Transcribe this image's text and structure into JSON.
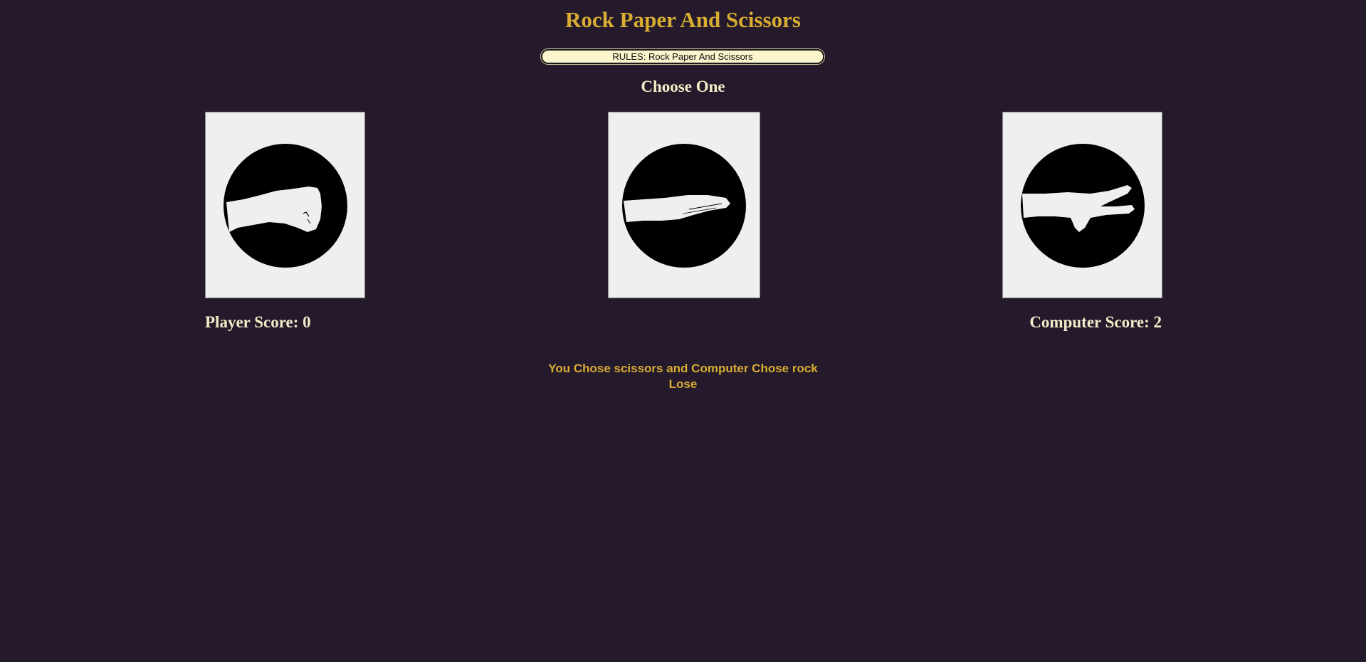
{
  "header": {
    "title": "Rock Paper And Scissors",
    "rules_button_label": "RULES: Rock Paper And Scissors",
    "choose_label": "Choose One"
  },
  "choices": [
    {
      "name": "rock",
      "icon": "rock-fist-icon"
    },
    {
      "name": "paper",
      "icon": "paper-hand-icon"
    },
    {
      "name": "scissors",
      "icon": "scissors-hand-icon"
    }
  ],
  "scores": {
    "player_label": "Player Score: 0",
    "computer_label": "Computer Score: 2",
    "player": 0,
    "computer": 2
  },
  "result": {
    "line1": "You Chose scissors and Computer Chose rock",
    "line2": "Lose"
  },
  "colors": {
    "background": "#241a2b",
    "accent": "#d9ac32",
    "text": "#f4ecc8",
    "card": "#efefef",
    "rules_button": "#fbf4cc"
  }
}
